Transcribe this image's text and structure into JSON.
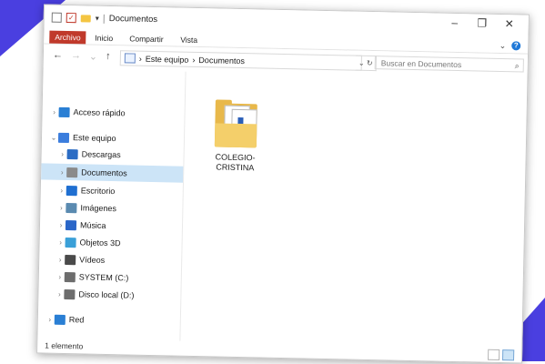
{
  "window": {
    "title": "Documentos",
    "controls": {
      "minimize": "–",
      "maximize": "❐",
      "close": "✕"
    }
  },
  "ribbon": {
    "tabs": [
      "Archivo",
      "Inicio",
      "Compartir",
      "Vista"
    ],
    "expand_glyph": "⌄",
    "help_glyph": "?"
  },
  "nav": {
    "back_glyph": "←",
    "forward_glyph": "→",
    "recent_glyph": "⌄",
    "up_glyph": "↑",
    "address": {
      "segments": [
        "Este equipo",
        "Documentos"
      ],
      "separator": "›"
    },
    "address_dropdown_glyph": "⌄ ↻",
    "search_placeholder": "Buscar en Documentos",
    "search_icon_glyph": "⌕"
  },
  "sidebar": {
    "items": [
      {
        "label": "Acceso rápido",
        "icon": "star-icon",
        "indent": 0,
        "arrow": "›",
        "selected": false
      },
      {
        "label": "Este equipo",
        "icon": "computer-icon",
        "indent": 0,
        "arrow": "⌄",
        "selected": false
      },
      {
        "label": "Descargas",
        "icon": "download-icon",
        "indent": 1,
        "arrow": "›",
        "selected": false
      },
      {
        "label": "Documentos",
        "icon": "document-icon",
        "indent": 1,
        "arrow": "›",
        "selected": true
      },
      {
        "label": "Escritorio",
        "icon": "desktop-icon",
        "indent": 1,
        "arrow": "›",
        "selected": false
      },
      {
        "label": "Imágenes",
        "icon": "image-icon",
        "indent": 1,
        "arrow": "›",
        "selected": false
      },
      {
        "label": "Música",
        "icon": "music-icon",
        "indent": 1,
        "arrow": "›",
        "selected": false
      },
      {
        "label": "Objetos 3D",
        "icon": "cube-icon",
        "indent": 1,
        "arrow": "›",
        "selected": false
      },
      {
        "label": "Vídeos",
        "icon": "video-icon",
        "indent": 1,
        "arrow": "›",
        "selected": false
      },
      {
        "label": "SYSTEM (C:)",
        "icon": "drive-icon",
        "indent": 1,
        "arrow": "›",
        "selected": false
      },
      {
        "label": "Disco local (D:)",
        "icon": "drive-icon",
        "indent": 1,
        "arrow": "›",
        "selected": false
      },
      {
        "label": "Red",
        "icon": "network-icon",
        "indent": 0,
        "arrow": "›",
        "selected": false
      }
    ]
  },
  "content": {
    "items": [
      {
        "name": "COLEGIO-CRISTINA",
        "type": "folder"
      }
    ]
  },
  "status": {
    "count": "1 elemento"
  },
  "colors": {
    "accent": "#4a3fe0",
    "file_tab": "#c0392b",
    "selection": "#cce4f7",
    "folder": "#f4cf6a"
  }
}
